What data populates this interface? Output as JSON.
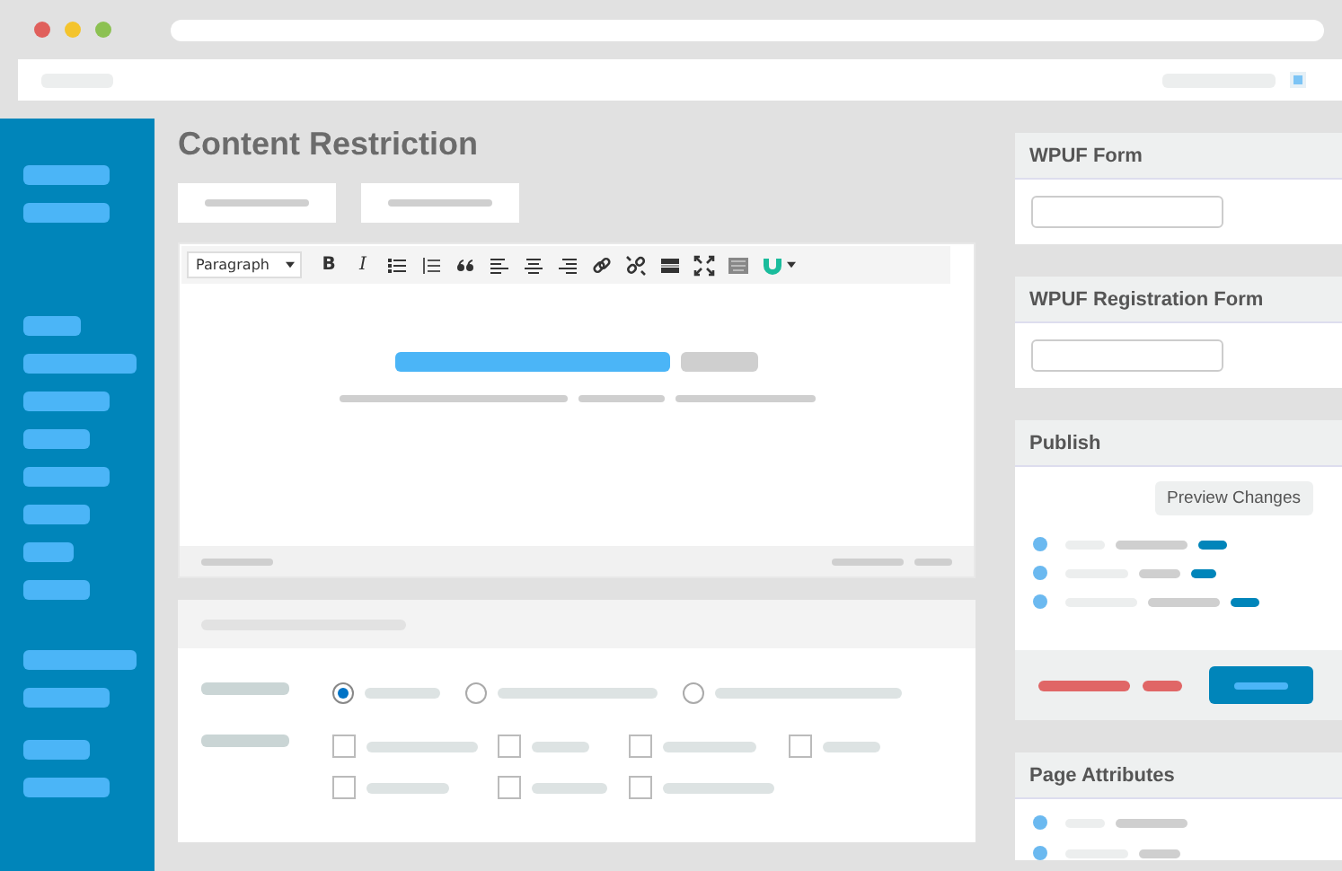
{
  "page_title": "Content Restriction",
  "editor": {
    "format": "Paragraph",
    "toolbar": [
      {
        "kind": "bold",
        "label": "B"
      },
      {
        "kind": "italic",
        "label": "I"
      },
      {
        "kind": "bullet-list"
      },
      {
        "kind": "numbered-list"
      },
      {
        "kind": "quote"
      },
      {
        "kind": "align-left"
      },
      {
        "kind": "align-center"
      },
      {
        "kind": "align-right"
      },
      {
        "kind": "link"
      },
      {
        "kind": "unlink"
      },
      {
        "kind": "read-more"
      },
      {
        "kind": "fullscreen"
      },
      {
        "kind": "keyboard"
      },
      {
        "kind": "plugin"
      }
    ]
  },
  "restriction": {
    "radios": [
      {
        "selected": true
      },
      {
        "selected": false
      },
      {
        "selected": false
      }
    ],
    "checkboxes": [
      {
        "checked": false
      },
      {
        "checked": false
      },
      {
        "checked": false
      },
      {
        "checked": false
      },
      {
        "checked": false
      },
      {
        "checked": false
      },
      {
        "checked": false
      }
    ]
  },
  "sidebar_boxes": [
    {
      "kind": "select",
      "title": "WPUF Form"
    },
    {
      "kind": "select",
      "title": "WPUF Registration Form"
    },
    {
      "kind": "publish",
      "title": "Publish",
      "button": "Preview Changes"
    },
    {
      "kind": "attributes",
      "title": "Page Attributes"
    }
  ]
}
